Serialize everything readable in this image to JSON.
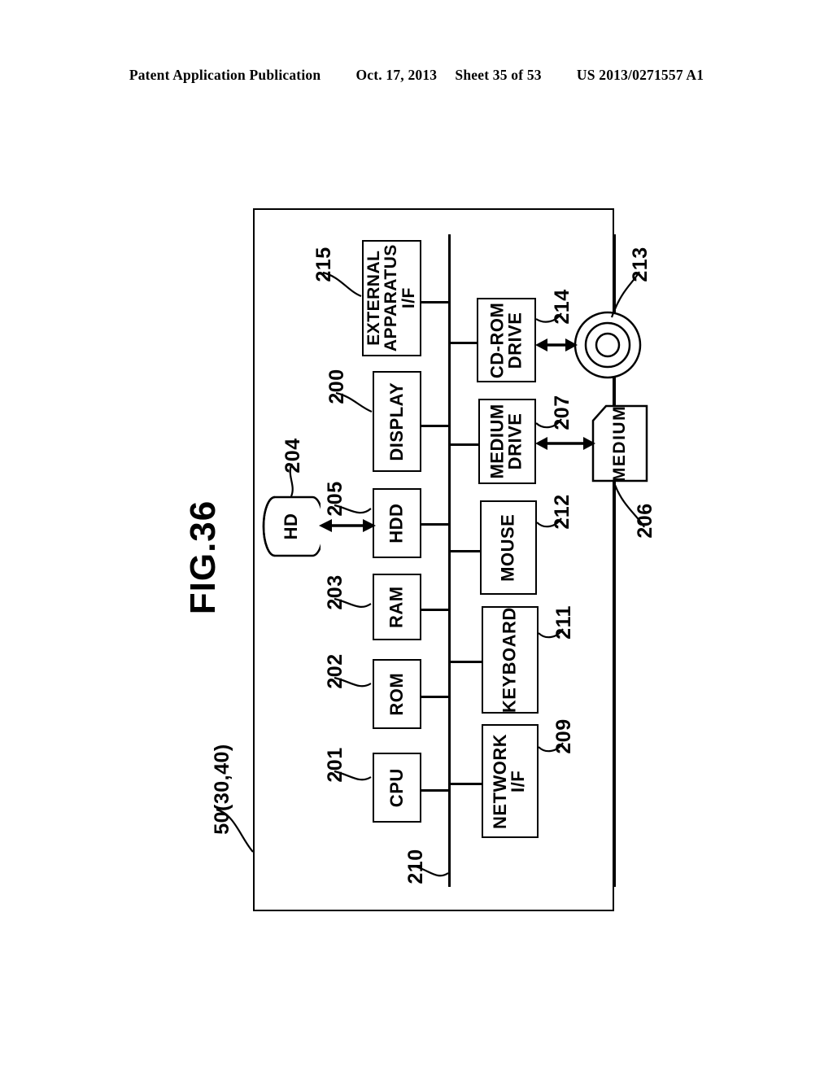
{
  "header": {
    "publication": "Patent Application Publication",
    "date": "Oct. 17, 2013",
    "sheet": "Sheet 35 of 53",
    "patent_number": "US 2013/0271557 A1"
  },
  "figure": {
    "title": "FIG.36",
    "apparatus_label": "50(30,40)",
    "bus_ref": "210",
    "blocks": [
      {
        "id": "external-apparatus-if",
        "label": "EXTERNAL\nAPPARATUS\nI/F",
        "ref": "215"
      },
      {
        "id": "display",
        "label": "DISPLAY",
        "ref": "200"
      },
      {
        "id": "hdd",
        "label": "HDD",
        "ref": "205"
      },
      {
        "id": "ram",
        "label": "RAM",
        "ref": "203"
      },
      {
        "id": "rom",
        "label": "ROM",
        "ref": "202"
      },
      {
        "id": "cpu",
        "label": "CPU",
        "ref": "201"
      },
      {
        "id": "cd-rom-drive",
        "label": "CD-ROM\nDRIVE",
        "ref": "214"
      },
      {
        "id": "medium-drive",
        "label": "MEDIUM\nDRIVE",
        "ref": "207"
      },
      {
        "id": "mouse",
        "label": "MOUSE",
        "ref": "212"
      },
      {
        "id": "keyboard",
        "label": "KEYBOARD",
        "ref": "211"
      },
      {
        "id": "network-if",
        "label": "NETWORK\nI/F",
        "ref": "209"
      }
    ],
    "peripherals": [
      {
        "id": "hd",
        "label": "HD",
        "ref": "204"
      },
      {
        "id": "cd-rom",
        "label": "",
        "ref": "213"
      },
      {
        "id": "medium",
        "label": "MEDIUM",
        "ref": "206"
      }
    ]
  },
  "colors": {
    "ink": "#000000",
    "paper": "#ffffff"
  }
}
